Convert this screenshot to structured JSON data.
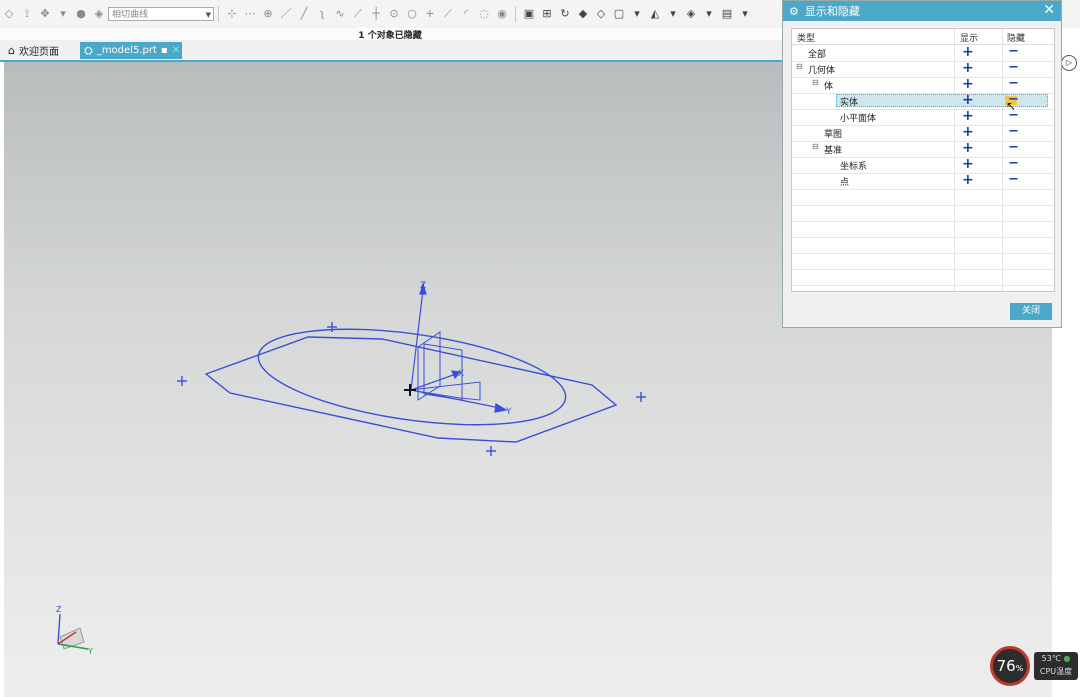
{
  "toolbar": {
    "curve_combo_value": "相切曲线"
  },
  "status_message": "1 个对象已隐藏",
  "tabs": [
    {
      "label": "欢迎页面"
    },
    {
      "label": "_model5.prt"
    }
  ],
  "dialog": {
    "title": "显示和隐藏",
    "columns": {
      "type": "类型",
      "show": "显示",
      "hide": "隐藏"
    },
    "rows": [
      {
        "label": "全部"
      },
      {
        "label": "几何体"
      },
      {
        "label": "体"
      },
      {
        "label": "实体",
        "selected": true
      },
      {
        "label": "小平面体"
      },
      {
        "label": "草图"
      },
      {
        "label": "基准"
      },
      {
        "label": "坐标系"
      },
      {
        "label": "点"
      }
    ],
    "close_button": "关闭"
  },
  "viewport": {
    "axis_z": "Z",
    "axis_y": "Y",
    "axis_x": "X",
    "triad_z": "Z",
    "triad_y": "Y"
  },
  "cpu": {
    "usage": "76",
    "usage_unit": "%",
    "temp": "53℃",
    "label": "CPU温度"
  },
  "colors": {
    "accent": "#4ba8c8",
    "geometry": "#3a4fd8",
    "plus_minus": "#1a3ea8"
  }
}
